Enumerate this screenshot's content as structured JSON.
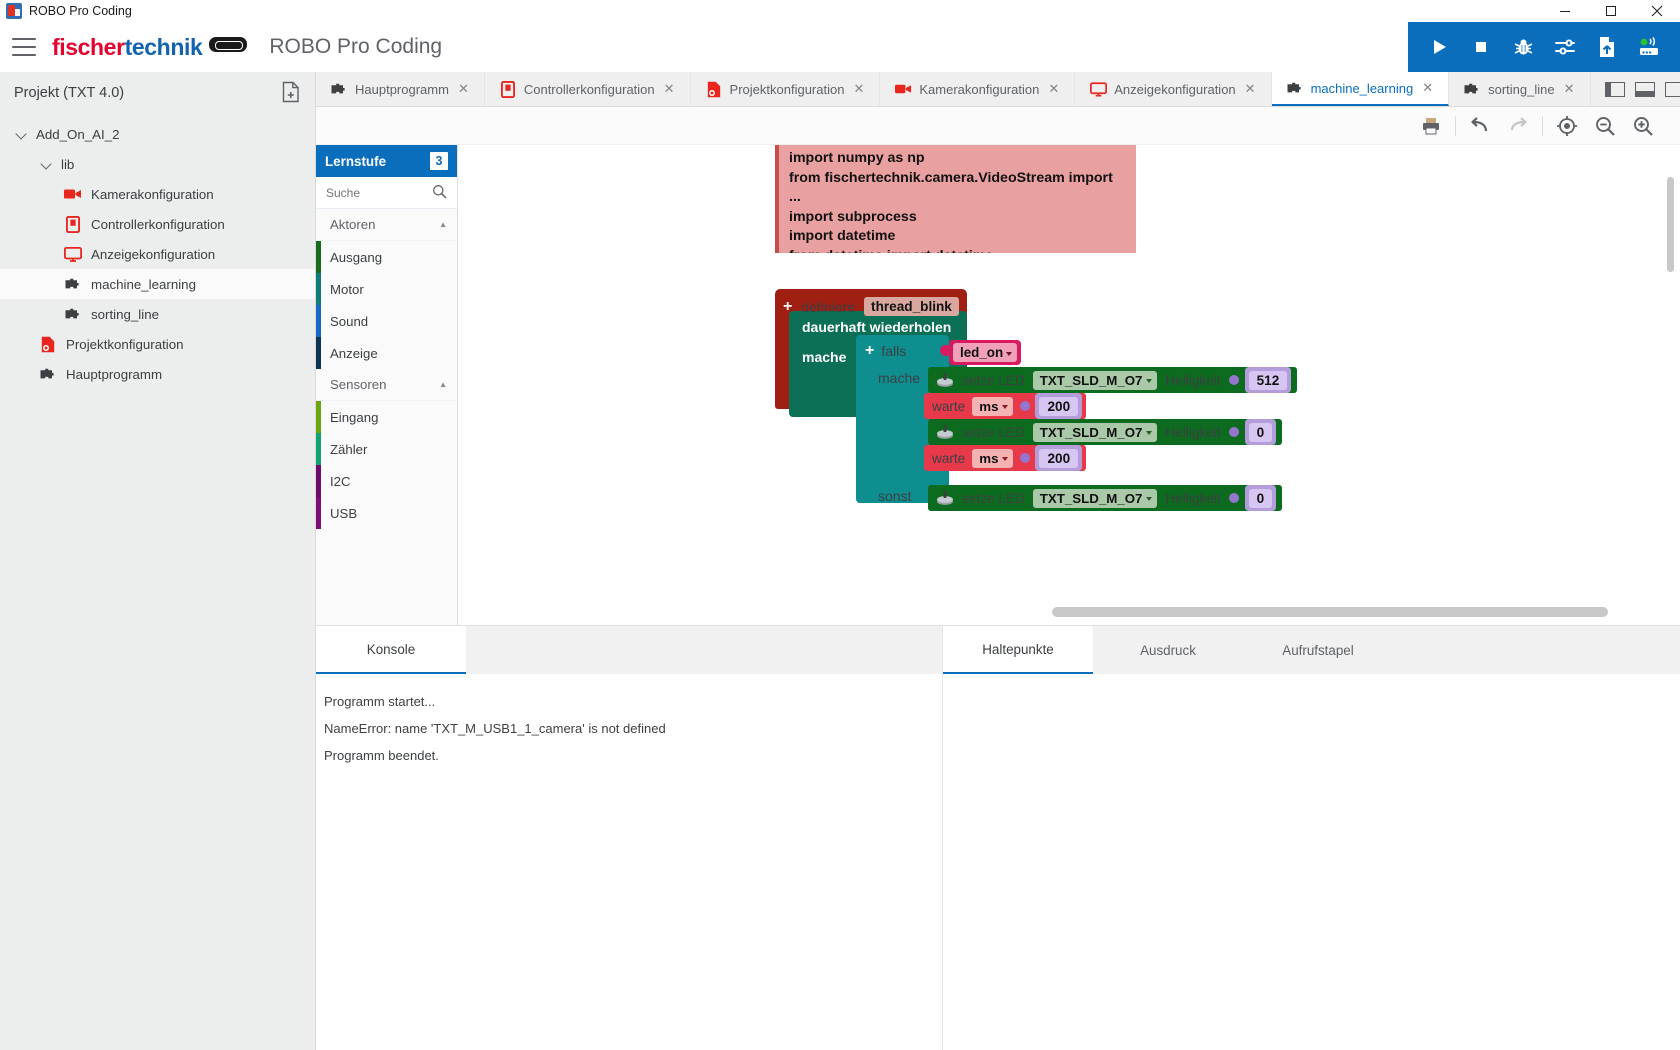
{
  "window": {
    "title": "ROBO Pro Coding",
    "minimize": "─",
    "maximize": "❐",
    "close": "✕"
  },
  "header": {
    "brand_first": "fischer",
    "brand_second": "technik",
    "app_title": "ROBO Pro Coding",
    "actions": [
      {
        "name": "run-button",
        "label": "Start"
      },
      {
        "name": "stop-button",
        "label": "Stop"
      },
      {
        "name": "debug-button",
        "label": "Debug"
      },
      {
        "name": "settings-sliders-button",
        "label": "Einstellungen"
      },
      {
        "name": "upload-file-button",
        "label": "Hochladen"
      },
      {
        "name": "controller-connection-button",
        "label": "Verbindung"
      }
    ]
  },
  "sidebar": {
    "title": "Projekt (TXT 4.0)",
    "new_file_label": "Neue Datei",
    "tree": [
      {
        "label": "Add_On_AI_2",
        "depth": 0,
        "type": "folder",
        "expanded": true
      },
      {
        "label": "lib",
        "depth": 1,
        "type": "folder",
        "expanded": true
      },
      {
        "label": "Kamerakonfiguration",
        "depth": 2,
        "type": "camera"
      },
      {
        "label": "Controllerkonfiguration",
        "depth": 2,
        "type": "controller"
      },
      {
        "label": "Anzeigekonfiguration",
        "depth": 2,
        "type": "display"
      },
      {
        "label": "machine_learning",
        "depth": 2,
        "type": "blocks",
        "selected": true
      },
      {
        "label": "sorting_line",
        "depth": 2,
        "type": "blocks"
      },
      {
        "label": "Projektkonfiguration",
        "depth": 1,
        "type": "projectfile"
      },
      {
        "label": "Hauptprogramm",
        "depth": 1,
        "type": "blocks"
      }
    ]
  },
  "tabs": [
    {
      "label": "Hauptprogramm",
      "icon": "blocks-icon",
      "active": false
    },
    {
      "label": "Controllerkonfiguration",
      "icon": "controller-icon",
      "active": false
    },
    {
      "label": "Projektkonfiguration",
      "icon": "projectfile-icon",
      "active": false
    },
    {
      "label": "Kamerakonfiguration",
      "icon": "camera-icon",
      "active": false
    },
    {
      "label": "Anzeigekonfiguration",
      "icon": "display-icon",
      "active": false
    },
    {
      "label": "machine_learning",
      "icon": "blocks-icon",
      "active": true
    },
    {
      "label": "sorting_line",
      "icon": "blocks-icon",
      "active": false
    }
  ],
  "tab_close_glyph": "✕",
  "editor_toolbar": [
    {
      "name": "print-button",
      "label": "Drucken"
    },
    {
      "name": "undo-button",
      "label": "Rückgängig"
    },
    {
      "name": "redo-button",
      "label": "Wiederholen"
    },
    {
      "name": "center-blocks-button",
      "label": "Zentrieren"
    },
    {
      "name": "zoom-out-button",
      "label": "Verkleinern"
    },
    {
      "name": "zoom-in-button",
      "label": "Vergrößern"
    }
  ],
  "toolbox": {
    "level_label": "Lernstufe",
    "level_value": "3",
    "search_placeholder": "Suche",
    "search_value": "",
    "groups": [
      {
        "header": "Aktoren",
        "items": [
          {
            "label": "Ausgang",
            "color": "#1a6b1a"
          },
          {
            "label": "Motor",
            "color": "#0f7d7d"
          },
          {
            "label": "Sound",
            "color": "#1569c7"
          },
          {
            "label": "Anzeige",
            "color": "#0d3552"
          }
        ]
      },
      {
        "header": "Sensoren",
        "items": [
          {
            "label": "Eingang",
            "color": "#6aa512"
          },
          {
            "label": "Zähler",
            "color": "#12a372"
          },
          {
            "label": "I2C",
            "color": "#6c0b6c"
          },
          {
            "label": "USB",
            "color": "#7a0f7a"
          }
        ]
      }
    ]
  },
  "code_block": {
    "lines": [
      "import numpy as np",
      "from fischertechnik.camera.VideoStream import ...",
      "import subprocess",
      "import datetime",
      "from datetime import datetime"
    ]
  },
  "blocks": {
    "define_label": "definiere",
    "define_name": "thread_blink",
    "plus_glyph": "+",
    "repeat_label": "dauerhaft wiederholen",
    "repeat_do_label": "mache",
    "if_label": "falls",
    "if_do_label": "mache",
    "else_label": "sonst",
    "condition_variable": "led_on",
    "statements": [
      {
        "kind": "led",
        "label": "setze LED",
        "port": "TXT_SLD_M_O7",
        "param": "Helligkeit",
        "value": "512"
      },
      {
        "kind": "wait",
        "label": "warte",
        "unit": "ms",
        "value": "200"
      },
      {
        "kind": "led",
        "label": "setze LED",
        "port": "TXT_SLD_M_O7",
        "param": "Helligkeit",
        "value": "0"
      },
      {
        "kind": "wait",
        "label": "warte",
        "unit": "ms",
        "value": "200"
      }
    ],
    "else_statement": {
      "kind": "led",
      "label": "setze LED",
      "port": "TXT_SLD_M_O7",
      "param": "Helligkeit",
      "value": "0"
    }
  },
  "console": {
    "left_tabs": [
      {
        "label": "Konsole",
        "active": true
      }
    ],
    "right_tabs": [
      {
        "label": "Haltepunkte",
        "active": true
      },
      {
        "label": "Ausdruck",
        "active": false
      },
      {
        "label": "Aufrufstapel",
        "active": false
      }
    ],
    "log": [
      "Programm startet...",
      "NameError: name 'TXT_M_USB1_1_camera' is not defined",
      "Programm beendet."
    ]
  },
  "colors": {
    "accent": "#0a6ebd",
    "brand_red": "#e4032e",
    "brand_blue": "#1263b0",
    "error_block": "#e9a0a0",
    "define_block": "#9f1f13",
    "loop_block": "#0c7057",
    "if_block": "#0e8e8e",
    "led_block": "#0c6b1e",
    "wait_block": "#e8394a",
    "number_block": "#b39ddb",
    "variable_block": "#d81b60"
  }
}
